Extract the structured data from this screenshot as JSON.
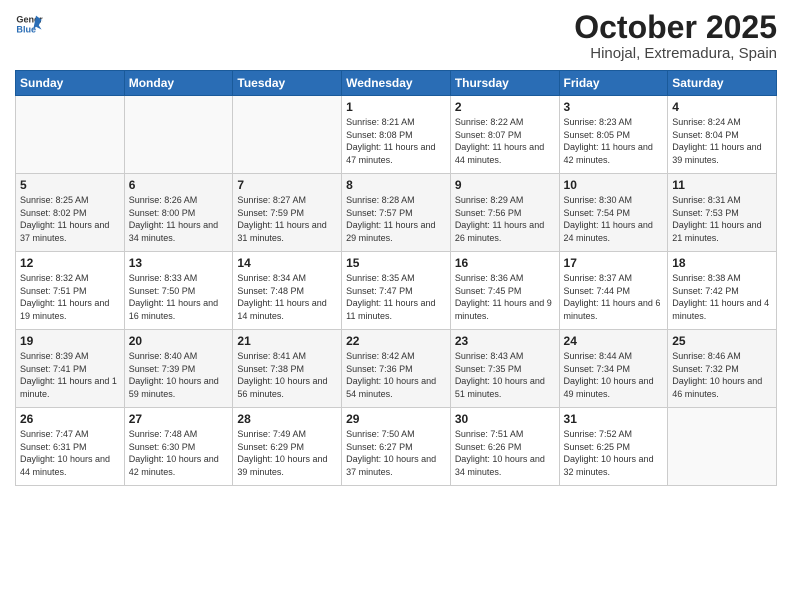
{
  "header": {
    "logo_line1": "General",
    "logo_line2": "Blue",
    "month": "October 2025",
    "location": "Hinojal, Extremadura, Spain"
  },
  "days_of_week": [
    "Sunday",
    "Monday",
    "Tuesday",
    "Wednesday",
    "Thursday",
    "Friday",
    "Saturday"
  ],
  "weeks": [
    [
      {
        "day": "",
        "info": ""
      },
      {
        "day": "",
        "info": ""
      },
      {
        "day": "",
        "info": ""
      },
      {
        "day": "1",
        "info": "Sunrise: 8:21 AM\nSunset: 8:08 PM\nDaylight: 11 hours and 47 minutes."
      },
      {
        "day": "2",
        "info": "Sunrise: 8:22 AM\nSunset: 8:07 PM\nDaylight: 11 hours and 44 minutes."
      },
      {
        "day": "3",
        "info": "Sunrise: 8:23 AM\nSunset: 8:05 PM\nDaylight: 11 hours and 42 minutes."
      },
      {
        "day": "4",
        "info": "Sunrise: 8:24 AM\nSunset: 8:04 PM\nDaylight: 11 hours and 39 minutes."
      }
    ],
    [
      {
        "day": "5",
        "info": "Sunrise: 8:25 AM\nSunset: 8:02 PM\nDaylight: 11 hours and 37 minutes."
      },
      {
        "day": "6",
        "info": "Sunrise: 8:26 AM\nSunset: 8:00 PM\nDaylight: 11 hours and 34 minutes."
      },
      {
        "day": "7",
        "info": "Sunrise: 8:27 AM\nSunset: 7:59 PM\nDaylight: 11 hours and 31 minutes."
      },
      {
        "day": "8",
        "info": "Sunrise: 8:28 AM\nSunset: 7:57 PM\nDaylight: 11 hours and 29 minutes."
      },
      {
        "day": "9",
        "info": "Sunrise: 8:29 AM\nSunset: 7:56 PM\nDaylight: 11 hours and 26 minutes."
      },
      {
        "day": "10",
        "info": "Sunrise: 8:30 AM\nSunset: 7:54 PM\nDaylight: 11 hours and 24 minutes."
      },
      {
        "day": "11",
        "info": "Sunrise: 8:31 AM\nSunset: 7:53 PM\nDaylight: 11 hours and 21 minutes."
      }
    ],
    [
      {
        "day": "12",
        "info": "Sunrise: 8:32 AM\nSunset: 7:51 PM\nDaylight: 11 hours and 19 minutes."
      },
      {
        "day": "13",
        "info": "Sunrise: 8:33 AM\nSunset: 7:50 PM\nDaylight: 11 hours and 16 minutes."
      },
      {
        "day": "14",
        "info": "Sunrise: 8:34 AM\nSunset: 7:48 PM\nDaylight: 11 hours and 14 minutes."
      },
      {
        "day": "15",
        "info": "Sunrise: 8:35 AM\nSunset: 7:47 PM\nDaylight: 11 hours and 11 minutes."
      },
      {
        "day": "16",
        "info": "Sunrise: 8:36 AM\nSunset: 7:45 PM\nDaylight: 11 hours and 9 minutes."
      },
      {
        "day": "17",
        "info": "Sunrise: 8:37 AM\nSunset: 7:44 PM\nDaylight: 11 hours and 6 minutes."
      },
      {
        "day": "18",
        "info": "Sunrise: 8:38 AM\nSunset: 7:42 PM\nDaylight: 11 hours and 4 minutes."
      }
    ],
    [
      {
        "day": "19",
        "info": "Sunrise: 8:39 AM\nSunset: 7:41 PM\nDaylight: 11 hours and 1 minute."
      },
      {
        "day": "20",
        "info": "Sunrise: 8:40 AM\nSunset: 7:39 PM\nDaylight: 10 hours and 59 minutes."
      },
      {
        "day": "21",
        "info": "Sunrise: 8:41 AM\nSunset: 7:38 PM\nDaylight: 10 hours and 56 minutes."
      },
      {
        "day": "22",
        "info": "Sunrise: 8:42 AM\nSunset: 7:36 PM\nDaylight: 10 hours and 54 minutes."
      },
      {
        "day": "23",
        "info": "Sunrise: 8:43 AM\nSunset: 7:35 PM\nDaylight: 10 hours and 51 minutes."
      },
      {
        "day": "24",
        "info": "Sunrise: 8:44 AM\nSunset: 7:34 PM\nDaylight: 10 hours and 49 minutes."
      },
      {
        "day": "25",
        "info": "Sunrise: 8:46 AM\nSunset: 7:32 PM\nDaylight: 10 hours and 46 minutes."
      }
    ],
    [
      {
        "day": "26",
        "info": "Sunrise: 7:47 AM\nSunset: 6:31 PM\nDaylight: 10 hours and 44 minutes."
      },
      {
        "day": "27",
        "info": "Sunrise: 7:48 AM\nSunset: 6:30 PM\nDaylight: 10 hours and 42 minutes."
      },
      {
        "day": "28",
        "info": "Sunrise: 7:49 AM\nSunset: 6:29 PM\nDaylight: 10 hours and 39 minutes."
      },
      {
        "day": "29",
        "info": "Sunrise: 7:50 AM\nSunset: 6:27 PM\nDaylight: 10 hours and 37 minutes."
      },
      {
        "day": "30",
        "info": "Sunrise: 7:51 AM\nSunset: 6:26 PM\nDaylight: 10 hours and 34 minutes."
      },
      {
        "day": "31",
        "info": "Sunrise: 7:52 AM\nSunset: 6:25 PM\nDaylight: 10 hours and 32 minutes."
      },
      {
        "day": "",
        "info": ""
      }
    ]
  ]
}
